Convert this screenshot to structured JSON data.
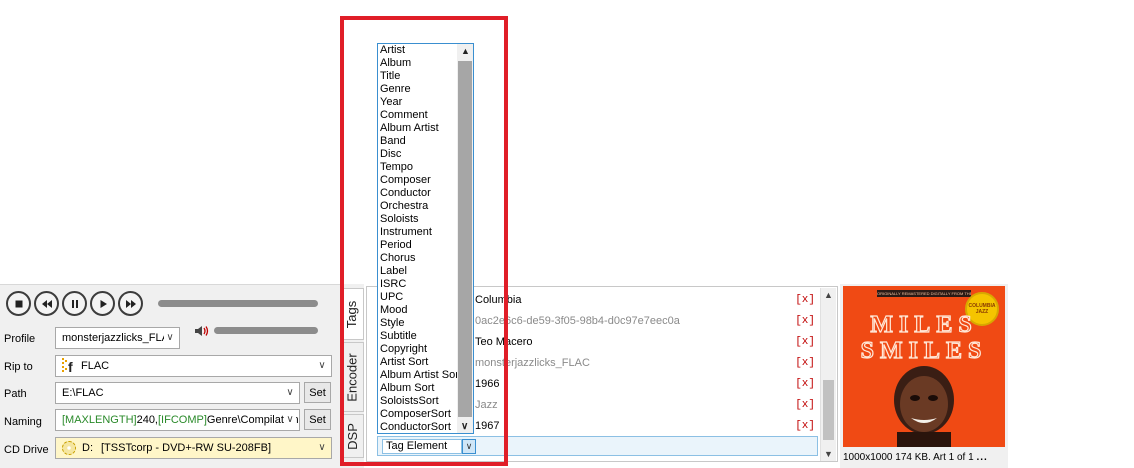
{
  "player": {
    "buttons": [
      "stop",
      "previous",
      "pause",
      "play",
      "next"
    ]
  },
  "form": {
    "profile_label": "Profile",
    "profile_value": "monsterjazzlicks_FLA",
    "ripto_label": "Rip to",
    "ripto_value": "FLAC",
    "path_label": "Path",
    "path_value": "E:\\FLAC",
    "set_label": "Set",
    "naming_label": "Naming",
    "naming_prefix": "[MAXLENGTH]",
    "naming_num": "240,",
    "naming_ifcomp": "[IFCOMP]",
    "naming_rest": "Genre\\Compilation",
    "cddrive_label": "CD Drive",
    "cddrive_letter": "D:",
    "cddrive_value": "[TSSTcorp - DVD+-RW SU-208FB]"
  },
  "tabs": {
    "tags": "Tags",
    "encoder": "Encoder",
    "dsp": "DSP"
  },
  "tag_rows": [
    {
      "value": "Columbia",
      "remove": "[x]"
    },
    {
      "value": "0ac2e6c6-de59-3f05-98b4-d0c97e7eec0a",
      "remove": "[x]"
    },
    {
      "value": "Teo Macero",
      "remove": "[x]"
    },
    {
      "value": "monsterjazzlicks_FLAC",
      "remove": "[x]"
    },
    {
      "value": "1966",
      "remove": "[x]"
    },
    {
      "value": "Jazz",
      "remove": "[x]"
    },
    {
      "value": "1967",
      "remove": "[x]"
    }
  ],
  "tag_add": {
    "value": "Tag Element"
  },
  "tag_list": [
    "Artist",
    "Album",
    "Title",
    "Genre",
    "Year",
    "Comment",
    "Album Artist",
    "Band",
    "Disc",
    "Tempo",
    "Composer",
    "Conductor",
    "Orchestra",
    "Soloists",
    "Instrument",
    "Period",
    "Chorus",
    "Label",
    "ISRC",
    "UPC",
    "Mood",
    "Style",
    "Subtitle",
    "Copyright",
    "Artist Sort",
    "Album Artist Sort",
    "Album Sort",
    "SoloistsSort",
    "ComposerSort",
    "ConductorSort"
  ],
  "album_art": {
    "banner": "ORIGINALLY REMASTERED DIGITALLY FROM THE ORIGINAL ANALOG TAPES",
    "title_line1": "MILES",
    "title_line2": "SMILES",
    "badge_line1": "COLUMBIA",
    "badge_line2": "JAZZ",
    "info": "1000x1000 174 KB. Art 1 of 1",
    "more": "..."
  },
  "colors": {
    "highlight": "#e01e28",
    "cover": "#f04a14",
    "remove": "#c00000",
    "selection": "#3a8fd0"
  }
}
